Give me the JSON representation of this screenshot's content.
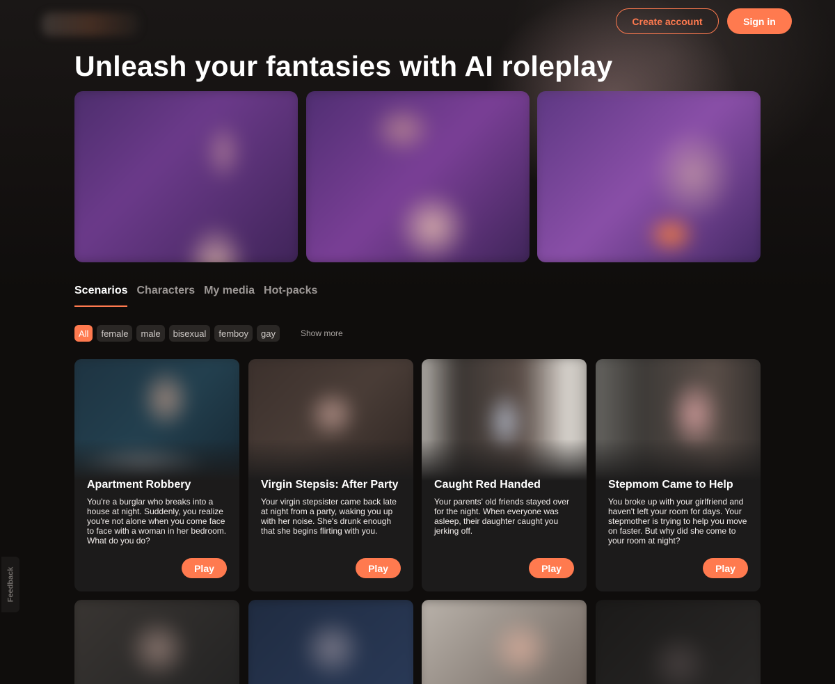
{
  "header": {
    "create_account_label": "Create account",
    "sign_in_label": "Sign in"
  },
  "hero": {
    "title": "Unleash your fantasies with AI roleplay"
  },
  "tabs": [
    {
      "label": "Scenarios",
      "active": true
    },
    {
      "label": "Characters",
      "active": false
    },
    {
      "label": "My media",
      "active": false
    },
    {
      "label": "Hot-packs",
      "active": false
    }
  ],
  "filters": {
    "chips": [
      {
        "label": "All",
        "active": true
      },
      {
        "label": "female",
        "active": false
      },
      {
        "label": "male",
        "active": false
      },
      {
        "label": "bisexual",
        "active": false
      },
      {
        "label": "femboy",
        "active": false
      },
      {
        "label": "gay",
        "active": false
      }
    ],
    "show_more_label": "Show more"
  },
  "cards": [
    {
      "title": "Apartment Robbery",
      "description": "You're a burglar who breaks into a house at night. Suddenly, you realize you're not alone when you come face to face with a woman in her bedroom. What do you do?",
      "play_label": "Play"
    },
    {
      "title": "Virgin Stepsis: After Party",
      "description": "Your virgin stepsister came back late at night from a party, waking you up with her noise. She's drunk enough that she begins flirting with you.",
      "play_label": "Play"
    },
    {
      "title": "Caught Red Handed",
      "description": "Your parents' old friends stayed over for the night. When everyone was asleep, their daughter caught you jerking off.",
      "play_label": "Play"
    },
    {
      "title": "Stepmom Came to Help",
      "description": "You broke up with your girlfriend and haven't left your room for days. Your stepmother is trying to help you move on faster. But why did she come to your room at night?",
      "play_label": "Play"
    }
  ],
  "feedback_label": "Feedback",
  "colors": {
    "accent": "#ff7a4f",
    "background": "#0f0d0c",
    "card": "#1c1b1b"
  }
}
